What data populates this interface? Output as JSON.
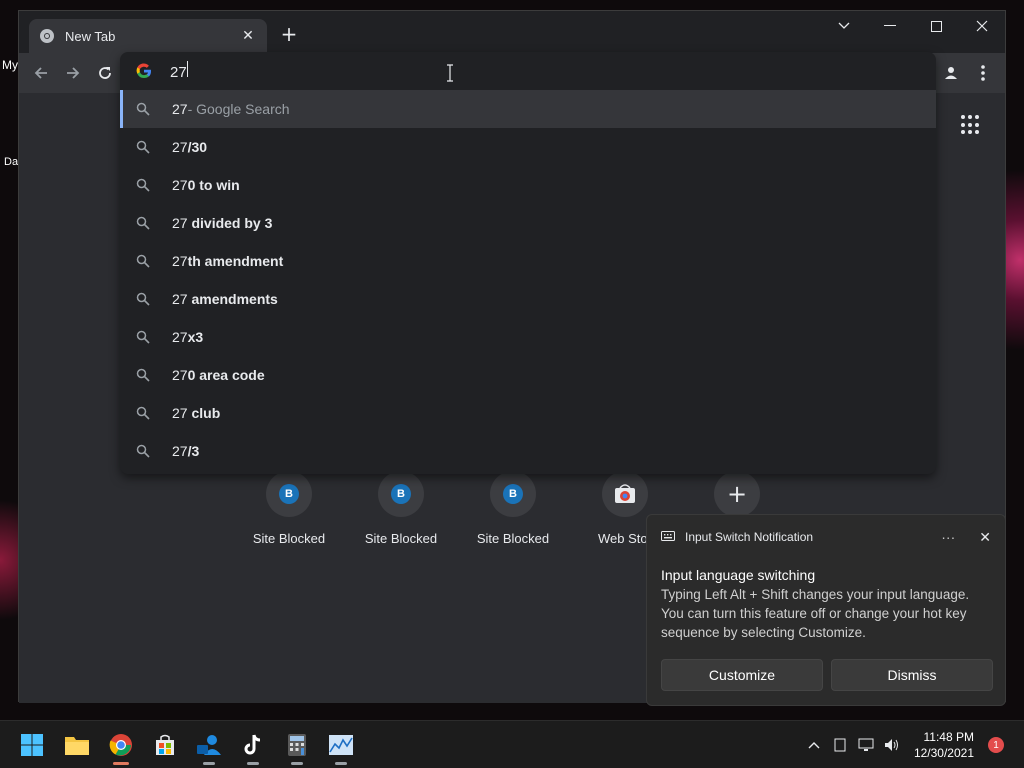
{
  "desktop": {
    "label_1": "My",
    "label_2": "Da"
  },
  "browser": {
    "tab": {
      "title": "New Tab"
    },
    "omnibox": {
      "value": "27",
      "suggestions": [
        {
          "typed": "27",
          "rest": "",
          "desc": " - Google Search"
        },
        {
          "typed": "27",
          "rest": "/30",
          "desc": ""
        },
        {
          "typed": "27",
          "rest": "0 to win",
          "desc": ""
        },
        {
          "typed": "27",
          "rest": " divided by 3",
          "desc": ""
        },
        {
          "typed": "27",
          "rest": "th amendment",
          "desc": ""
        },
        {
          "typed": "27",
          "rest": " amendments",
          "desc": ""
        },
        {
          "typed": "27",
          "rest": "x3",
          "desc": ""
        },
        {
          "typed": "27",
          "rest": "0 area code",
          "desc": ""
        },
        {
          "typed": "27",
          "rest": " club",
          "desc": ""
        },
        {
          "typed": "27",
          "rest": "/3",
          "desc": ""
        }
      ]
    },
    "shortcuts": [
      {
        "badge": "B",
        "label": "Site Blocked"
      },
      {
        "badge": "B",
        "label": "Site Blocked"
      },
      {
        "badge": "B",
        "label": "Site Blocked"
      },
      {
        "badge": "",
        "label": "Web Stor"
      },
      {
        "badge": "+",
        "label": ""
      }
    ]
  },
  "notification": {
    "app": "Input Switch Notification",
    "more": "···",
    "title": "Input language switching",
    "body": "Typing Left Alt + Shift changes your input language. You can turn this feature off or change your hot key sequence by selecting Customize.",
    "customize_label": "Customize",
    "dismiss_label": "Dismiss"
  },
  "taskbar": {
    "time": "11:48 PM",
    "date": "12/30/2021",
    "notification_count": "1"
  },
  "colors": {
    "accent": "#8ab4f8",
    "chrome_dark": "#202124",
    "toolbar": "#35363a",
    "badge_blue": "#1a73b8",
    "alert_red": "#e34c4c"
  }
}
